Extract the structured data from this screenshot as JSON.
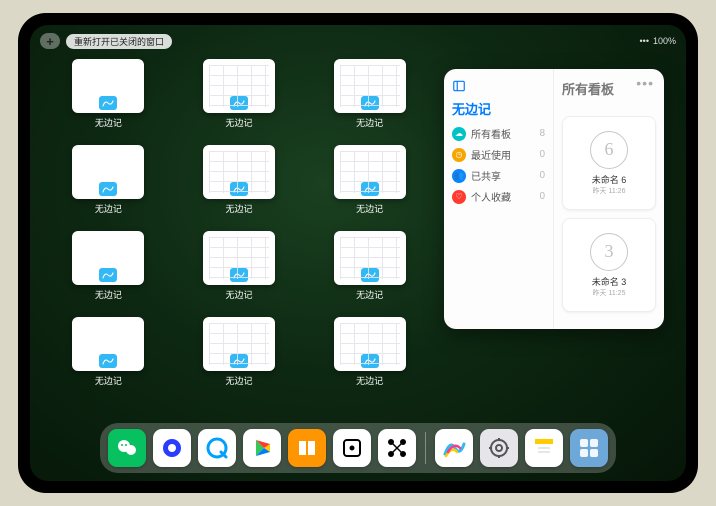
{
  "status": {
    "battery_text": "100%",
    "signal": "•••"
  },
  "topbar": {
    "plus_label": "+",
    "reopen_label": "重新打开已关闭的窗口"
  },
  "app_switcher": {
    "thumbs": [
      {
        "label": "无边记",
        "style": "blank"
      },
      {
        "label": "无边记",
        "style": "grid"
      },
      {
        "label": "无边记",
        "style": "grid"
      },
      {
        "label": "无边记",
        "style": "blank"
      },
      {
        "label": "无边记",
        "style": "grid"
      },
      {
        "label": "无边记",
        "style": "grid"
      },
      {
        "label": "无边记",
        "style": "blank"
      },
      {
        "label": "无边记",
        "style": "grid"
      },
      {
        "label": "无边记",
        "style": "grid"
      },
      {
        "label": "无边记",
        "style": "blank"
      },
      {
        "label": "无边记",
        "style": "grid"
      },
      {
        "label": "无边记",
        "style": "grid"
      }
    ]
  },
  "popover": {
    "left_title": "无边记",
    "right_title": "所有看板",
    "ellipsis": "•••",
    "categories": [
      {
        "icon_color": "#00c3c9",
        "glyph": "☁",
        "label": "所有看板",
        "count": "8"
      },
      {
        "icon_color": "#f7a500",
        "glyph": "◷",
        "label": "最近使用",
        "count": "0"
      },
      {
        "icon_color": "#0a84ff",
        "glyph": "👥",
        "label": "已共享",
        "count": "0"
      },
      {
        "icon_color": "#ff3b30",
        "glyph": "♡",
        "label": "个人收藏",
        "count": "0"
      }
    ],
    "boards": [
      {
        "sketch": "6",
        "name": "未命名 6",
        "sub": "昨天 11:26"
      },
      {
        "sketch": "3",
        "name": "未命名 3",
        "sub": "昨天 11:25"
      }
    ]
  },
  "dock": {
    "apps": [
      {
        "name": "wechat",
        "bg": "#07c160",
        "glyph": "wechat"
      },
      {
        "name": "quark",
        "bg": "#ffffff",
        "glyph": "quark"
      },
      {
        "name": "qqbrowser",
        "bg": "#ffffff",
        "glyph": "qqbrowser"
      },
      {
        "name": "play",
        "bg": "#ffffff",
        "glyph": "play"
      },
      {
        "name": "books",
        "bg": "#ff9500",
        "glyph": "books"
      },
      {
        "name": "dice",
        "bg": "#ffffff",
        "glyph": "dice"
      },
      {
        "name": "nodes",
        "bg": "#ffffff",
        "glyph": "nodes"
      }
    ],
    "recent": [
      {
        "name": "freeform",
        "bg": "#ffffff",
        "glyph": "freeform"
      },
      {
        "name": "settings",
        "bg": "#e5e5ea",
        "glyph": "gear"
      },
      {
        "name": "notes",
        "bg": "#ffffff",
        "glyph": "notes"
      },
      {
        "name": "app-library",
        "bg": "#6ea8d9",
        "glyph": "grid4"
      }
    ]
  }
}
